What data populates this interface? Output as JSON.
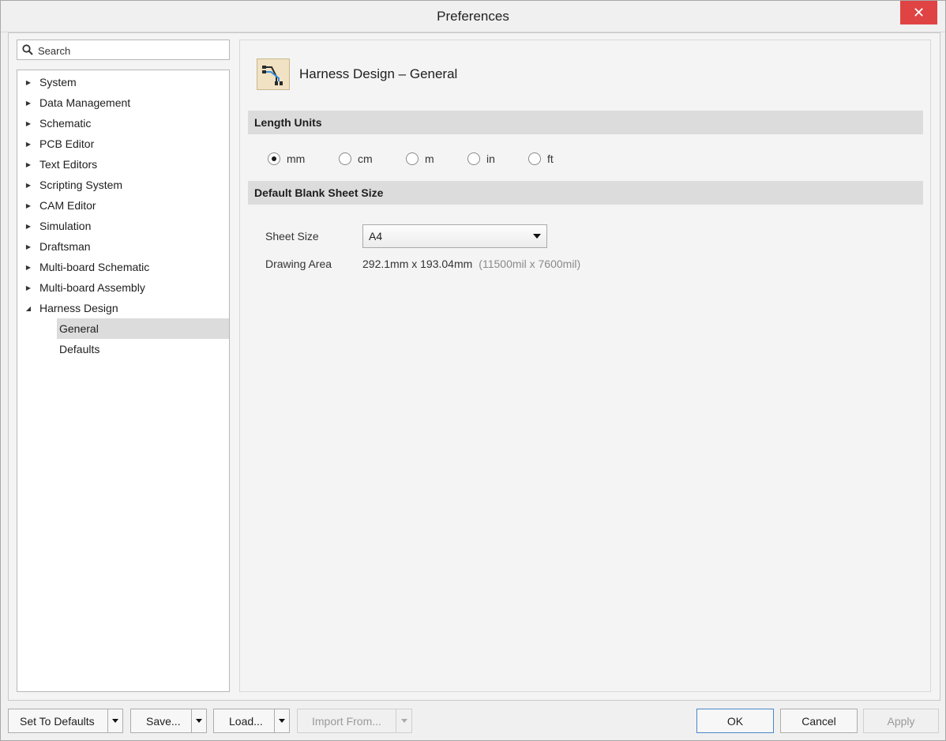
{
  "window": {
    "title": "Preferences",
    "close_label": "✕"
  },
  "search": {
    "placeholder": "Search"
  },
  "tree": {
    "items": [
      {
        "label": "System",
        "expanded": false
      },
      {
        "label": "Data Management",
        "expanded": false
      },
      {
        "label": "Schematic",
        "expanded": false
      },
      {
        "label": "PCB Editor",
        "expanded": false
      },
      {
        "label": "Text Editors",
        "expanded": false
      },
      {
        "label": "Scripting System",
        "expanded": false
      },
      {
        "label": "CAM Editor",
        "expanded": false
      },
      {
        "label": "Simulation",
        "expanded": false
      },
      {
        "label": "Draftsman",
        "expanded": false
      },
      {
        "label": "Multi-board Schematic",
        "expanded": false
      },
      {
        "label": "Multi-board Assembly",
        "expanded": false
      },
      {
        "label": "Harness Design",
        "expanded": true
      }
    ],
    "children": [
      {
        "label": "General",
        "selected": true
      },
      {
        "label": "Defaults",
        "selected": false
      }
    ]
  },
  "page": {
    "title": "Harness Design – General",
    "icon": "harness-design-icon",
    "length_units": {
      "header": "Length Units",
      "options": [
        "mm",
        "cm",
        "m",
        "in",
        "ft"
      ],
      "selected": "mm"
    },
    "sheet": {
      "header": "Default Blank Sheet Size",
      "size_label": "Sheet Size",
      "size_value": "A4",
      "area_label": "Drawing Area",
      "area_value": "292.1mm x 193.04mm",
      "area_mil": "(11500mil x 7600mil)"
    }
  },
  "footer": {
    "set_defaults": "Set To Defaults",
    "save": "Save...",
    "load": "Load...",
    "import": "Import From...",
    "ok": "OK",
    "cancel": "Cancel",
    "apply": "Apply"
  },
  "colors": {
    "close": "#e04343",
    "selected_row": "#dcdcdc",
    "section_header": "#dcdcdc",
    "icon_bg": "#f0e2c2"
  }
}
